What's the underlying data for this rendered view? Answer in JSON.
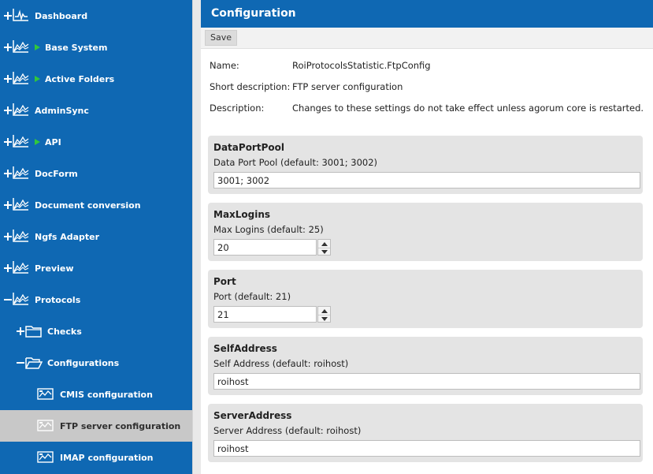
{
  "sidebar": {
    "items": [
      {
        "label": "Dashboard",
        "expander": "plus",
        "icon": "dashboard-icon",
        "marker": false
      },
      {
        "label": "Base System",
        "expander": "plus",
        "icon": "chart-icon",
        "marker": true
      },
      {
        "label": "Active Folders",
        "expander": "plus",
        "icon": "chart-icon",
        "marker": true
      },
      {
        "label": "AdminSync",
        "expander": "plus",
        "icon": "chart-icon",
        "marker": false
      },
      {
        "label": "API",
        "expander": "plus",
        "icon": "chart-icon",
        "marker": true
      },
      {
        "label": "DocForm",
        "expander": "plus",
        "icon": "chart-icon",
        "marker": false
      },
      {
        "label": "Document conversion",
        "expander": "plus",
        "icon": "chart-icon",
        "marker": false
      },
      {
        "label": "Ngfs Adapter",
        "expander": "plus",
        "icon": "chart-icon",
        "marker": false
      },
      {
        "label": "Preview",
        "expander": "plus",
        "icon": "chart-icon",
        "marker": false
      },
      {
        "label": "Protocols",
        "expander": "minus",
        "icon": "chart-icon",
        "marker": false
      },
      {
        "label": "Checks",
        "expander": "plus",
        "icon": "folder-icon",
        "marker": false
      },
      {
        "label": "Configurations",
        "expander": "minus",
        "icon": "folder-open-icon",
        "marker": false
      },
      {
        "label": "CMIS configuration",
        "expander": "none",
        "icon": "config-icon",
        "marker": false
      },
      {
        "label": "FTP server configuration",
        "expander": "none",
        "icon": "config-icon",
        "marker": false,
        "selected": true
      },
      {
        "label": "IMAP configuration",
        "expander": "none",
        "icon": "config-icon",
        "marker": false
      }
    ]
  },
  "header": {
    "title": "Configuration"
  },
  "toolbar": {
    "save_label": "Save"
  },
  "info": {
    "name_label": "Name:",
    "name_value": "RoiProtocolsStatistic.FtpConfig",
    "short_label": "Short description:",
    "short_value": "FTP server configuration",
    "desc_label": "Description:",
    "desc_value": "Changes to these settings do not take effect unless agorum core is restarted."
  },
  "settings": [
    {
      "title": "DataPortPool",
      "label": "Data Port Pool (default: 3001; 3002)",
      "value": "3001; 3002",
      "kind": "text"
    },
    {
      "title": "MaxLogins",
      "label": "Max Logins (default: 25)",
      "value": "20",
      "kind": "number"
    },
    {
      "title": "Port",
      "label": "Port (default: 21)",
      "value": "21",
      "kind": "number"
    },
    {
      "title": "SelfAddress",
      "label": "Self Address (default: roihost)",
      "value": "roihost",
      "kind": "text"
    },
    {
      "title": "ServerAddress",
      "label": "Server Address (default: roihost)",
      "value": "roihost",
      "kind": "text"
    }
  ],
  "colors": {
    "sidebar_bg": "#0f68b3",
    "header_bg": "#0f68b3",
    "selected_bg": "#c8c8c8",
    "marker": "#31c73b",
    "panel_bg": "#e4e4e4"
  }
}
